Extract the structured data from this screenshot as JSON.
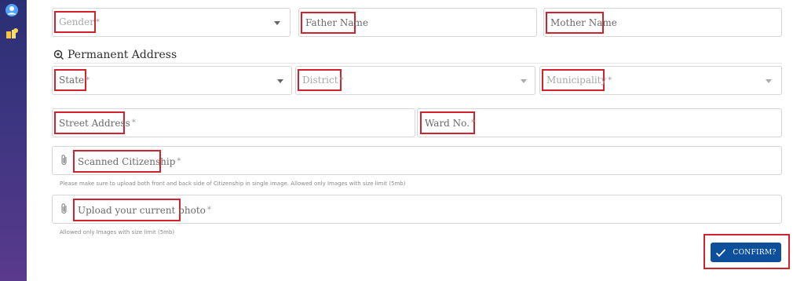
{
  "sidebar": {
    "icons": [
      "user-icon",
      "medal-icon"
    ]
  },
  "fields": {
    "gender": {
      "label": "Gender",
      "req": "*"
    },
    "father": {
      "label": "Father Name"
    },
    "mother": {
      "label": "Mother Name"
    },
    "state": {
      "label": "State",
      "req": "*"
    },
    "district": {
      "label": "District",
      "req": "*"
    },
    "municipality": {
      "label": "Municipality",
      "req": "*"
    },
    "street": {
      "label": "Street Address",
      "req": "*"
    },
    "ward": {
      "label": "Ward No.",
      "req": "*"
    },
    "citizenship": {
      "label": "Scanned Citizenship",
      "req": "*"
    },
    "photo": {
      "label": "Upload your current photo",
      "req": "*"
    }
  },
  "section": {
    "title": "Permanent Address"
  },
  "hints": {
    "citizenship": "Please make sure to upload both front and back side of Citizenship in single image. Allowed only Images with size limit (5mb)",
    "photo": "Allowed only Images with size limit (5mb)"
  },
  "confirm": {
    "label": "CONFIRM?"
  }
}
